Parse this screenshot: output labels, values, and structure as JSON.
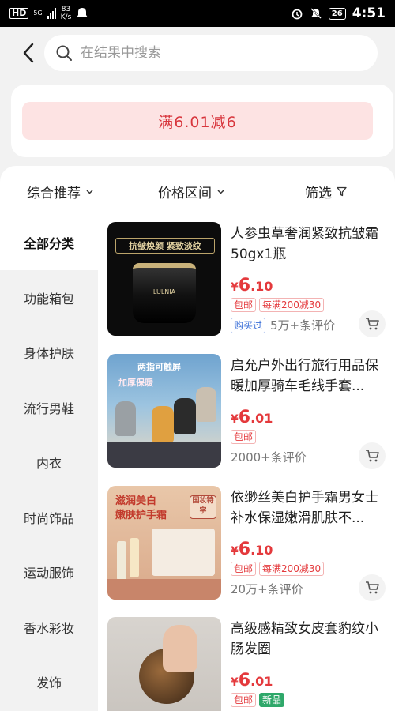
{
  "status_bar": {
    "hd": "HD",
    "network": "5G",
    "speed_value": "83",
    "speed_unit": "K/s",
    "battery": "26",
    "time": "4:51"
  },
  "search": {
    "placeholder": "在结果中搜索"
  },
  "promo": {
    "label": "满6.01减6"
  },
  "sort": {
    "comprehensive": "综合推荐",
    "price_range": "价格区间",
    "filter": "筛选"
  },
  "categories": [
    "全部分类",
    "功能箱包",
    "身体护肤",
    "流行男鞋",
    "内衣",
    "时尚饰品",
    "运动服饰",
    "香水彩妆",
    "发饰"
  ],
  "products": [
    {
      "title": "人参虫草奢润紧致抗皱霜50gx1瓶",
      "price_symbol": "¥",
      "price_int": "6",
      "price_dec": ".10",
      "tags": [
        "包邮",
        "每满200减30"
      ],
      "bought_label": "购买过",
      "reviews": "5万+条评价",
      "image_caption": "抗皱焕颜 紧致淡纹",
      "image_brand": "LULNIA"
    },
    {
      "title": "启允户外出行旅行用品保暖加厚骑车毛线手套...",
      "price_symbol": "¥",
      "price_int": "6",
      "price_dec": ".01",
      "tags": [
        "包邮"
      ],
      "reviews": "2000+条评价",
      "image_caption": "两指可触屏",
      "image_caption2": "加厚保暖"
    },
    {
      "title": "依缈丝美白护手霜男女士补水保湿嫩滑肌肤不...",
      "price_symbol": "¥",
      "price_int": "6",
      "price_dec": ".10",
      "tags": [
        "包邮",
        "每满200减30"
      ],
      "reviews": "20万+条评价",
      "image_caption": "滋润美白",
      "image_caption2": "嫩肤护手霜",
      "image_badge": "国妆特字"
    },
    {
      "title": "高级感精致女皮套豹纹小肠发圈",
      "price_symbol": "¥",
      "price_int": "6",
      "price_dec": ".01",
      "tags": [
        "包邮",
        "新品"
      ]
    }
  ]
}
